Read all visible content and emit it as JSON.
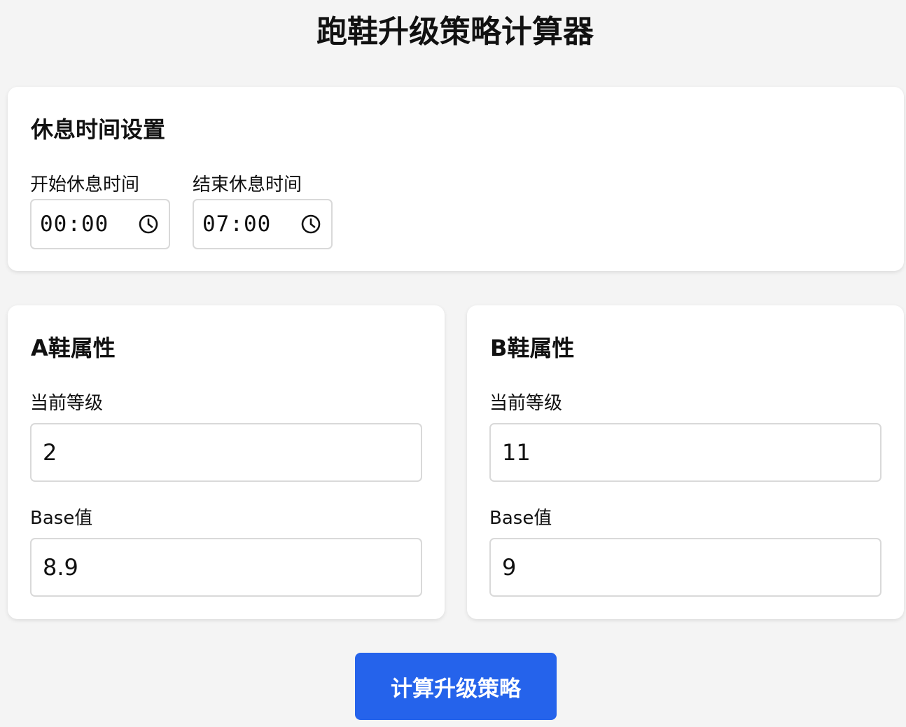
{
  "page": {
    "title": "跑鞋升级策略计算器"
  },
  "rest_settings": {
    "heading": "休息时间设置",
    "start_label": "开始休息时间",
    "start_value": "00:00",
    "end_label": "结束休息时间",
    "end_value": "07:00",
    "icon": "clock-icon"
  },
  "shoe_a": {
    "heading": "A鞋属性",
    "level_label": "当前等级",
    "level_value": "2",
    "base_label": "Base值",
    "base_value": "8.9"
  },
  "shoe_b": {
    "heading": "B鞋属性",
    "level_label": "当前等级",
    "level_value": "11",
    "base_label": "Base值",
    "base_value": "9"
  },
  "actions": {
    "calculate_label": "计算升级策略"
  },
  "colors": {
    "background": "#f4f4f4",
    "card": "#ffffff",
    "accent": "#2563eb",
    "input_border": "#d9d9d9"
  }
}
